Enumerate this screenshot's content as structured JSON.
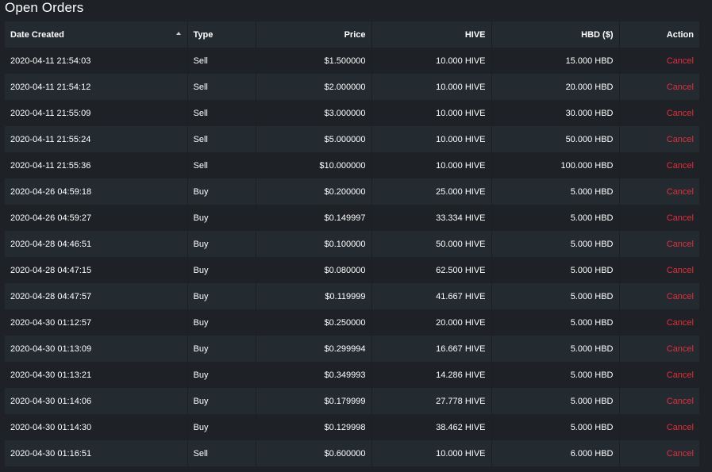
{
  "title": "Open Orders",
  "colors": {
    "cancel": "#e0303d",
    "row_alt": "#232a30",
    "background": "#1e2125"
  },
  "columns": {
    "date": "Date Created",
    "type": "Type",
    "price": "Price",
    "hive": "HIVE",
    "hbd": "HBD ($)",
    "action": "Action"
  },
  "sort": {
    "column": "Date Created",
    "direction": "ascending",
    "icon": "sort-up-icon"
  },
  "orders": [
    {
      "date": "2020-04-11 21:54:03",
      "type": "Sell",
      "price": "$1.500000",
      "hive": "10.000 HIVE",
      "hbd": "15.000 HBD",
      "action": "Cancel"
    },
    {
      "date": "2020-04-11 21:54:12",
      "type": "Sell",
      "price": "$2.000000",
      "hive": "10.000 HIVE",
      "hbd": "20.000 HBD",
      "action": "Cancel"
    },
    {
      "date": "2020-04-11 21:55:09",
      "type": "Sell",
      "price": "$3.000000",
      "hive": "10.000 HIVE",
      "hbd": "30.000 HBD",
      "action": "Cancel"
    },
    {
      "date": "2020-04-11 21:55:24",
      "type": "Sell",
      "price": "$5.000000",
      "hive": "10.000 HIVE",
      "hbd": "50.000 HBD",
      "action": "Cancel"
    },
    {
      "date": "2020-04-11 21:55:36",
      "type": "Sell",
      "price": "$10.000000",
      "hive": "10.000 HIVE",
      "hbd": "100.000 HBD",
      "action": "Cancel"
    },
    {
      "date": "2020-04-26 04:59:18",
      "type": "Buy",
      "price": "$0.200000",
      "hive": "25.000 HIVE",
      "hbd": "5.000 HBD",
      "action": "Cancel"
    },
    {
      "date": "2020-04-26 04:59:27",
      "type": "Buy",
      "price": "$0.149997",
      "hive": "33.334 HIVE",
      "hbd": "5.000 HBD",
      "action": "Cancel"
    },
    {
      "date": "2020-04-28 04:46:51",
      "type": "Buy",
      "price": "$0.100000",
      "hive": "50.000 HIVE",
      "hbd": "5.000 HBD",
      "action": "Cancel"
    },
    {
      "date": "2020-04-28 04:47:15",
      "type": "Buy",
      "price": "$0.080000",
      "hive": "62.500 HIVE",
      "hbd": "5.000 HBD",
      "action": "Cancel"
    },
    {
      "date": "2020-04-28 04:47:57",
      "type": "Buy",
      "price": "$0.119999",
      "hive": "41.667 HIVE",
      "hbd": "5.000 HBD",
      "action": "Cancel"
    },
    {
      "date": "2020-04-30 01:12:57",
      "type": "Buy",
      "price": "$0.250000",
      "hive": "20.000 HIVE",
      "hbd": "5.000 HBD",
      "action": "Cancel"
    },
    {
      "date": "2020-04-30 01:13:09",
      "type": "Buy",
      "price": "$0.299994",
      "hive": "16.667 HIVE",
      "hbd": "5.000 HBD",
      "action": "Cancel"
    },
    {
      "date": "2020-04-30 01:13:21",
      "type": "Buy",
      "price": "$0.349993",
      "hive": "14.286 HIVE",
      "hbd": "5.000 HBD",
      "action": "Cancel"
    },
    {
      "date": "2020-04-30 01:14:06",
      "type": "Buy",
      "price": "$0.179999",
      "hive": "27.778 HIVE",
      "hbd": "5.000 HBD",
      "action": "Cancel"
    },
    {
      "date": "2020-04-30 01:14:30",
      "type": "Buy",
      "price": "$0.129998",
      "hive": "38.462 HIVE",
      "hbd": "5.000 HBD",
      "action": "Cancel"
    },
    {
      "date": "2020-04-30 01:16:51",
      "type": "Sell",
      "price": "$0.600000",
      "hive": "10.000 HIVE",
      "hbd": "6.000 HBD",
      "action": "Cancel"
    }
  ]
}
